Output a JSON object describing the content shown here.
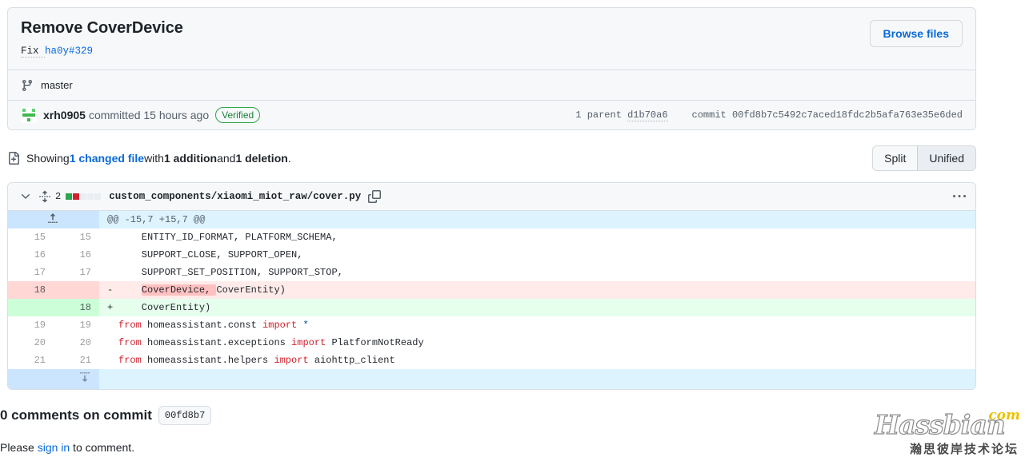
{
  "commit": {
    "title": "Remove CoverDevice",
    "description_prefix": "Fix ",
    "description_link": "ha0y#329",
    "browse_files_label": "Browse files",
    "branch_name": "master",
    "branch_icon": "git-branch-icon",
    "author": "xrh0905",
    "committed_text": "committed 15 hours ago",
    "verified_label": "Verified",
    "parent_label": "1 parent",
    "parent_sha": "d1b70a6",
    "commit_label": "commit",
    "commit_sha": "00fd8b7c5492c7aced18fdc2b5afa763e35e6ded"
  },
  "toolbar": {
    "showing_icon": "file-diff-icon",
    "showing_prefix": "Showing ",
    "changed_file_link": "1 changed file",
    "showing_mid": " with ",
    "additions": "1 addition",
    "showing_and": " and ",
    "deletions": "1 deletion",
    "showing_suffix": ".",
    "split_label": "Split",
    "unified_label": "Unified",
    "active_view": "Unified"
  },
  "file": {
    "chevron_icon": "chevron-down-icon",
    "diffstat_icon": "diff-stat-icon",
    "changes_count": "2",
    "diffstat_squares": [
      "add",
      "del",
      "neutral",
      "neutral",
      "neutral"
    ],
    "path": "custom_components/xiaomi_miot_raw/cover.py",
    "copy_icon": "copy-icon",
    "kebab_icon": "kebab-horizontal-icon"
  },
  "diff": {
    "hunk_header": "@@ -15,7 +15,7 @@",
    "expand_up_icon": "expand-up-icon",
    "expand_down_icon": "expand-down-icon",
    "rows": [
      {
        "type": "context",
        "old": "15",
        "new": "15",
        "marker": " ",
        "code": "    ENTITY_ID_FORMAT, PLATFORM_SCHEMA,"
      },
      {
        "type": "context",
        "old": "16",
        "new": "16",
        "marker": " ",
        "code": "    SUPPORT_CLOSE, SUPPORT_OPEN,"
      },
      {
        "type": "context",
        "old": "17",
        "new": "17",
        "marker": " ",
        "code": "    SUPPORT_SET_POSITION, SUPPORT_STOP,"
      },
      {
        "type": "deletion",
        "old": "18",
        "new": "",
        "marker": "-",
        "code": "    CoverDevice, CoverEntity)",
        "highlight": "CoverDevice, "
      },
      {
        "type": "addition",
        "old": "",
        "new": "18",
        "marker": "+",
        "code": "    CoverEntity)"
      },
      {
        "type": "context",
        "old": "19",
        "new": "19",
        "marker": " ",
        "code": "from homeassistant.const import *"
      },
      {
        "type": "context",
        "old": "20",
        "new": "20",
        "marker": " ",
        "code": "from homeassistant.exceptions import PlatformNotReady"
      },
      {
        "type": "context",
        "old": "21",
        "new": "21",
        "marker": " ",
        "code": "from homeassistant.helpers import aiohttp_client"
      }
    ]
  },
  "comments": {
    "title": "0 comments on commit",
    "sha_chip": "00fd8b7",
    "signin_prefix": "Please ",
    "signin_link": "sign in",
    "signin_suffix": " to comment."
  },
  "watermark": {
    "brand": "Hassbian",
    "tld": "com",
    "subtitle": "瀚思彼岸技术论坛"
  },
  "colors": {
    "link": "#0969da",
    "addition": "#2da44e",
    "deletion": "#cf222e",
    "verified": "#1a7f37"
  }
}
